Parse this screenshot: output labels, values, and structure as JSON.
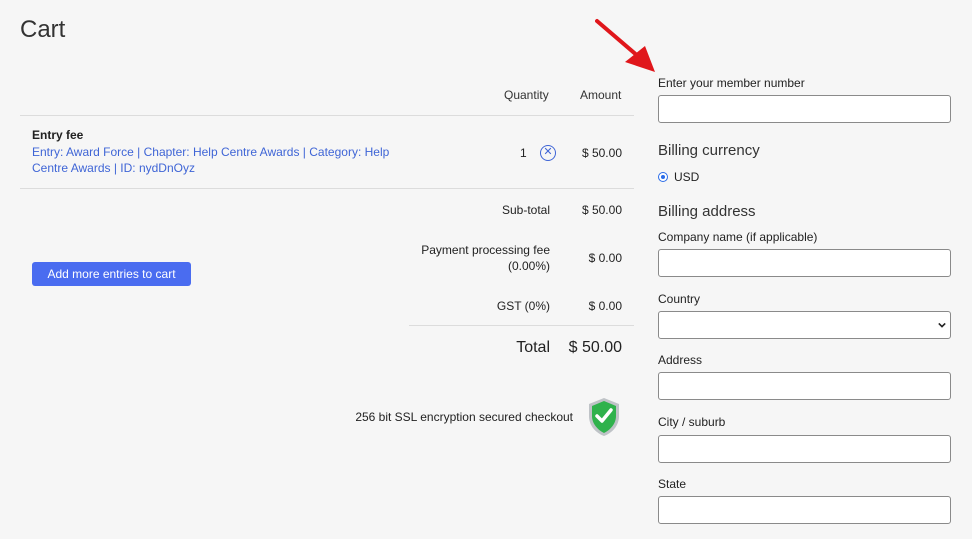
{
  "page": {
    "title": "Cart"
  },
  "table": {
    "quantity_header": "Quantity",
    "amount_header": "Amount",
    "item": {
      "title": "Entry fee",
      "link": "Entry: Award Force | Chapter: Help Centre Awards | Category: Help Centre Awards | ID: nydDnOyz",
      "quantity": "1",
      "amount": "$ 50.00"
    }
  },
  "summary": {
    "subtotal_label": "Sub-total",
    "subtotal_value": "$ 50.00",
    "fee_label": "Payment processing fee (0.00%)",
    "fee_value": "$ 0.00",
    "gst_label": "GST (0%)",
    "gst_value": "$ 0.00",
    "total_label": "Total",
    "total_value": "$ 50.00"
  },
  "actions": {
    "add_more_label": "Add more entries to cart"
  },
  "security": {
    "ssl_text": "256 bit SSL encryption secured checkout",
    "icon": "shield-check-icon",
    "color": "#2fb24c"
  },
  "form": {
    "member_number_label": "Enter your member number",
    "billing_currency_heading": "Billing currency",
    "currency_option": "USD",
    "billing_address_heading": "Billing address",
    "company_label": "Company name (if applicable)",
    "country_label": "Country",
    "address_label": "Address",
    "city_label": "City / suburb",
    "state_label": "State"
  },
  "colors": {
    "accent": "#4a6cf0",
    "link": "#3f65d6",
    "annotation_arrow": "#e0161b"
  }
}
